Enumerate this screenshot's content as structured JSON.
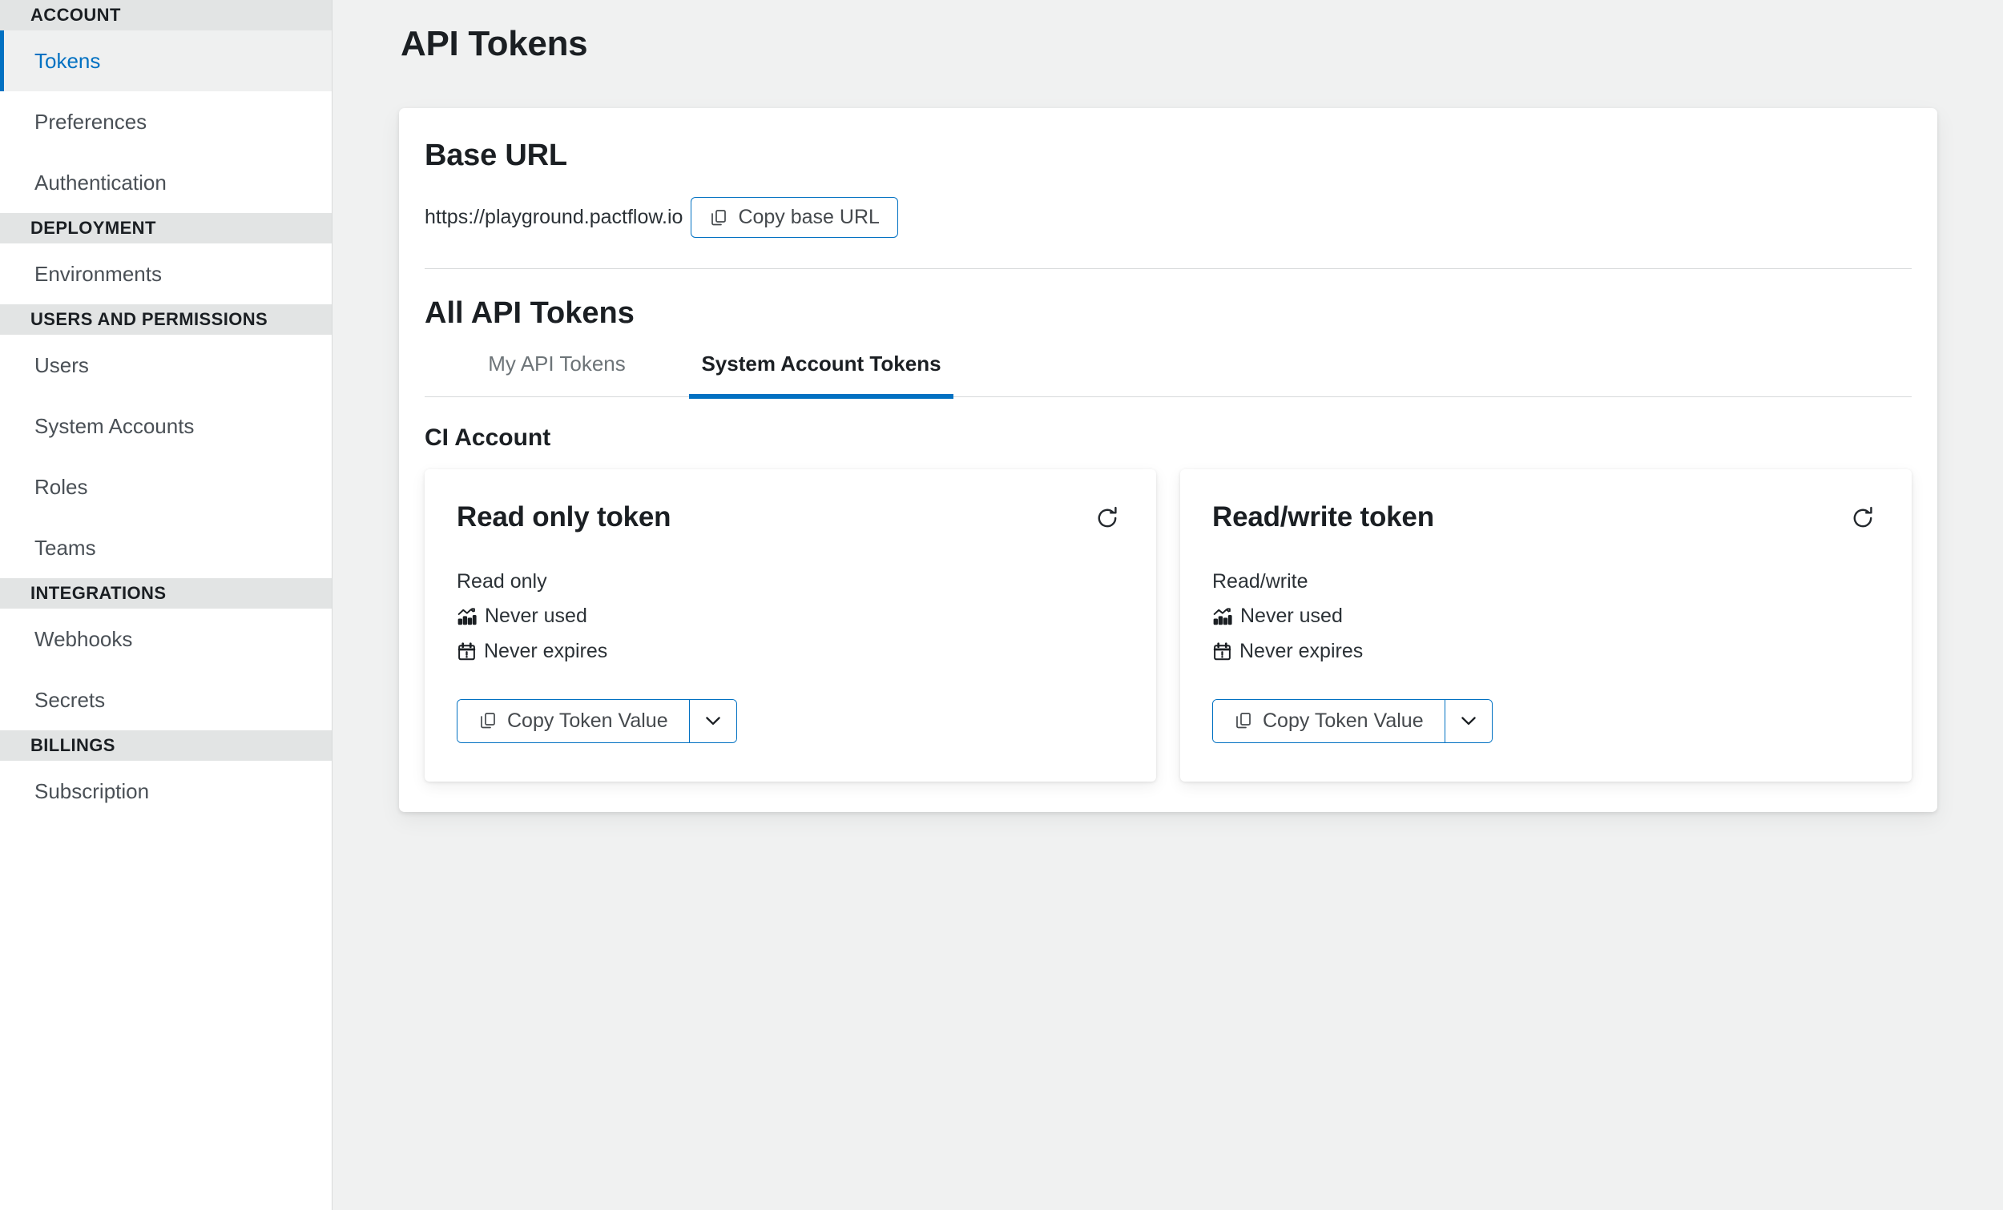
{
  "sidebar": {
    "groups": [
      {
        "header": "ACCOUNT",
        "items": [
          {
            "label": "Tokens",
            "active": true
          },
          {
            "label": "Preferences",
            "active": false
          },
          {
            "label": "Authentication",
            "active": false
          }
        ]
      },
      {
        "header": "DEPLOYMENT",
        "items": [
          {
            "label": "Environments",
            "active": false
          }
        ]
      },
      {
        "header": "USERS AND PERMISSIONS",
        "items": [
          {
            "label": "Users",
            "active": false
          },
          {
            "label": "System Accounts",
            "active": false
          },
          {
            "label": "Roles",
            "active": false
          },
          {
            "label": "Teams",
            "active": false
          }
        ]
      },
      {
        "header": "INTEGRATIONS",
        "items": [
          {
            "label": "Webhooks",
            "active": false
          },
          {
            "label": "Secrets",
            "active": false
          }
        ]
      },
      {
        "header": "BILLINGS",
        "items": [
          {
            "label": "Subscription",
            "active": false
          }
        ]
      }
    ]
  },
  "page": {
    "title": "API Tokens"
  },
  "base_url": {
    "heading": "Base URL",
    "value": "https://playground.pactflow.io",
    "copy_button_label": "Copy base URL"
  },
  "all_tokens": {
    "heading": "All API Tokens",
    "tabs": [
      {
        "label": "My API Tokens",
        "active": false
      },
      {
        "label": "System Account Tokens",
        "active": true
      }
    ],
    "account_name": "CI Account",
    "cards": [
      {
        "title": "Read only token",
        "scope": "Read only",
        "last_used": "Never used",
        "expiry": "Never expires",
        "copy_label": "Copy Token Value"
      },
      {
        "title": "Read/write token",
        "scope": "Read/write",
        "last_used": "Never used",
        "expiry": "Never expires",
        "copy_label": "Copy Token Value"
      }
    ]
  },
  "colors": {
    "accent": "#0271c2",
    "page_bg": "#f0f1f1",
    "section_header_bg": "#e2e4e4",
    "active_item_bg": "#eff0f0",
    "text": "#1b1f23",
    "muted_text": "#4a5056"
  }
}
